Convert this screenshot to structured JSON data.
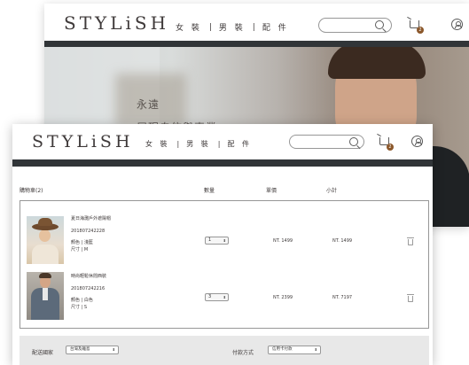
{
  "back_window": {
    "logo": "STYLiSH",
    "nav": [
      "女 裝",
      "男 裝",
      "配 件"
    ],
    "cart_count": "2",
    "hero_title": "永遠",
    "hero_subtitle": "展現自信與專業"
  },
  "front_window": {
    "logo": "STYLiSH",
    "nav": [
      "女 裝",
      "男 裝",
      "配 件"
    ],
    "cart_count": "2",
    "cart": {
      "heading": "購物車(2)",
      "col_quantity": "數量",
      "col_price": "單價",
      "col_subtotal": "小計",
      "items": [
        {
          "name": "夏日海灘戶外遮陽帽",
          "id": "201807242228",
          "color": "顏色 | 淺藍",
          "size": "尺寸 | M",
          "quantity": "1",
          "price": "NT. 1499",
          "subtotal": "NT. 1499"
        },
        {
          "name": "時尚輕鬆休閒西裝",
          "id": "201807242216",
          "color": "顏色 | 白色",
          "size": "尺寸 | S",
          "quantity": "3",
          "price": "NT. 2399",
          "subtotal": "NT. 7197"
        }
      ]
    },
    "checkout": {
      "country_label": "配送國家",
      "country_value": "台灣及離島",
      "payment_label": "付款方式",
      "payment_value": "信用卡付款"
    }
  },
  "colors": {
    "dark_bar": "#313538",
    "badge": "#8b572a",
    "text": "#3f3a3a",
    "checkout_bg": "#e8e8e8"
  }
}
